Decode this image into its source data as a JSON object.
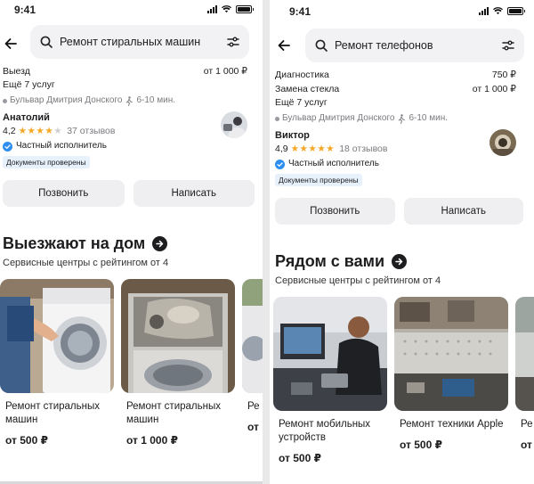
{
  "left": {
    "status": {
      "time": "9:41"
    },
    "search": {
      "query": "Ремонт стиральных машин"
    },
    "services": [
      {
        "name": "Выезд",
        "price": "от 1 000 ₽"
      }
    ],
    "more_services": "Ещё 7 услуг",
    "address": "Бульвар Дмитрия Донского",
    "walk_time": "6-10 мин.",
    "performer": {
      "name": "Анатолий",
      "rating": "4,2",
      "stars_filled": 4,
      "reviews": "37 отзывов",
      "type": "Частный исполнитель",
      "badge": "Документы проверены"
    },
    "actions": {
      "call": "Позвонить",
      "write": "Написать"
    },
    "section": {
      "title": "Выезжают на дом",
      "subtitle": "Сервисные центры с рейтингом от 4"
    },
    "cards": [
      {
        "title": "Ремонт стиральных машин",
        "price": "от 500 ₽",
        "image": "washing-machine-photo"
      },
      {
        "title": "Ремонт стиральных машин",
        "price": "от 1 000 ₽",
        "image": "open-washer-photo"
      },
      {
        "title": "Ре",
        "price": "от",
        "image": "washer-partial-photo"
      }
    ]
  },
  "right": {
    "status": {
      "time": "9:41"
    },
    "search": {
      "query": "Ремонт телефонов"
    },
    "services": [
      {
        "name": "Диагностика",
        "price": "750 ₽"
      },
      {
        "name": "Замена стекла",
        "price": "от 1 000 ₽"
      }
    ],
    "more_services": "Ещё 7 услуг",
    "address": "Бульвар Дмитрия Донского",
    "walk_time": "6-10 мин.",
    "performer": {
      "name": "Виктор",
      "rating": "4,9",
      "stars_filled": 5,
      "reviews": "18 отзывов",
      "type": "Частный исполнитель",
      "badge": "Документы проверены"
    },
    "actions": {
      "call": "Позвонить",
      "write": "Написать"
    },
    "section": {
      "title": "Рядом с вами",
      "subtitle": "Сервисные центры с рейтингом от 4"
    },
    "cards": [
      {
        "title": "Ремонт мобильных устройств",
        "price": "от 500 ₽",
        "image": "phone-repair-photo"
      },
      {
        "title": "Ремонт техники Apple",
        "price": "от 500 ₽",
        "image": "workshop-photo"
      },
      {
        "title": "Ре",
        "price": "от",
        "image": "workshop-partial-photo"
      }
    ]
  },
  "colors": {
    "accent_blue": "#2f8ff0",
    "star": "#f5a623",
    "button_bg": "#efeff1",
    "badge_bg": "#e7f1fb"
  }
}
